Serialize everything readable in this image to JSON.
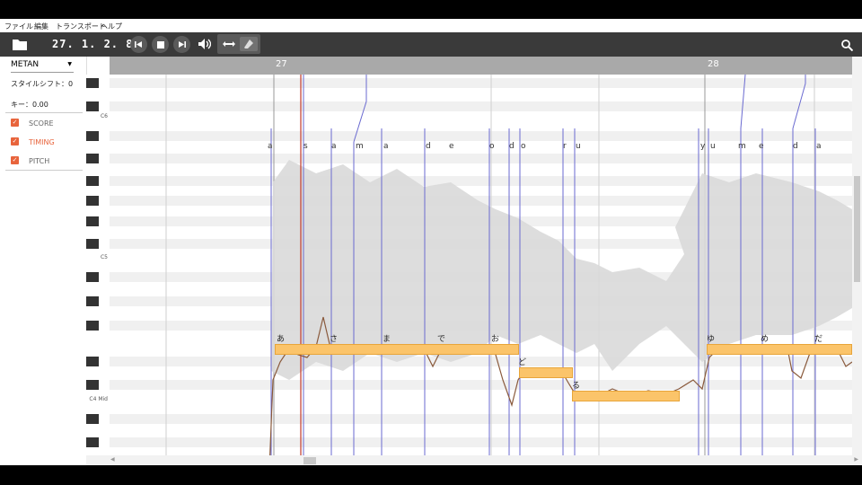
{
  "menu": [
    "ファイル",
    "編集",
    "トランスポート",
    "ヘルプ"
  ],
  "toolbar": {
    "timecode": "27. 1. 2. 8",
    "icons": [
      "folder-icon",
      "skip-back-icon",
      "stop-icon",
      "skip-forward-icon",
      "volume-icon",
      "horizontal-arrows-icon",
      "eraser-icon",
      "search-icon"
    ]
  },
  "panel": {
    "voice": "METAN",
    "style_shift_label": "スタイルシフト：0",
    "key_label": "キー：0.00",
    "checkboxes": [
      {
        "label": "SCORE",
        "color": "#666666"
      },
      {
        "label": "TIMING",
        "color": "#e8643c"
      },
      {
        "label": "PITCH",
        "color": "#666666"
      }
    ]
  },
  "keyboard": {
    "labels": [
      "C6",
      "C5",
      "C4 Mid"
    ]
  },
  "ruler": {
    "bars": [
      "27",
      "28"
    ]
  },
  "phonemes": [
    "a",
    "s",
    "a",
    "m",
    "a",
    "d",
    "e",
    "o",
    "d",
    "o",
    "r",
    "u",
    "y",
    "u",
    "m",
    "e",
    "d",
    "a"
  ],
  "lyrics": [
    "あ",
    "さ",
    "ま",
    "で",
    "お",
    "ど",
    "る",
    "ゆ",
    "め",
    "だ"
  ],
  "colors": {
    "note": "#fbc46a",
    "toolbar": "#3a3a3a",
    "accent": "#e8643c",
    "timing_line": "#5a5acd"
  }
}
